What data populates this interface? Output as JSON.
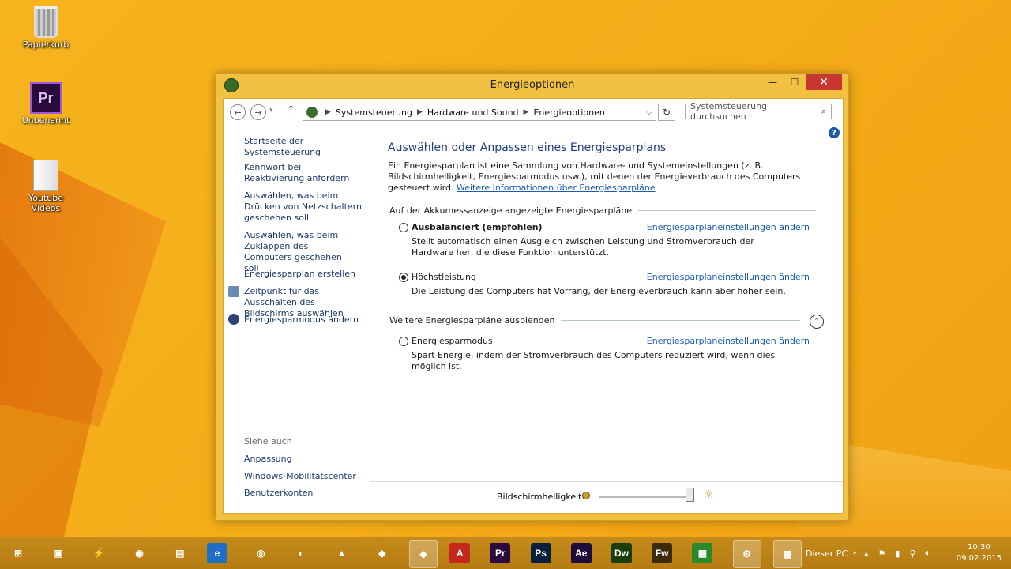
{
  "desktop": {
    "icons": [
      {
        "label": "Papierkorb",
        "icon": "recycle-bin-icon"
      },
      {
        "label": "Unbenannt",
        "icon": "premiere-project-icon",
        "badge": "PROJ",
        "glyph": "Pr"
      },
      {
        "label": "Youtube Videos",
        "icon": "folder-icon"
      }
    ]
  },
  "window": {
    "title": "Energieoptionen",
    "controls": {
      "minimize": "—",
      "maximize": "☐",
      "close": "✕"
    },
    "breadcrumb": [
      "Systemsteuerung",
      "Hardware und Sound",
      "Energieoptionen"
    ],
    "search_placeholder": "Systemsteuerung durchsuchen",
    "help": "?",
    "sidebar": {
      "home": "Startseite der Systemsteuerung",
      "links": [
        "Kennwort bei Reaktivierung anfordern",
        "Auswählen, was beim Drücken von Netzschaltern geschehen soll",
        "Auswählen, was beim Zuklappen des Computers geschehen soll",
        "Energiesparplan erstellen",
        "Zeitpunkt für das Ausschalten des Bildschirms auswählen",
        "Energiesparmodus ändern"
      ],
      "see_also_title": "Siehe auch",
      "see_also": [
        "Anpassung",
        "Windows-Mobilitätscenter",
        "Benutzerkonten"
      ]
    },
    "main": {
      "heading": "Auswählen oder Anpassen eines Energiesparplans",
      "intro": "Ein Energiesparplan ist eine Sammlung von Hardware- und Systemeinstellungen (z. B. Bildschirmhelligkeit, Energiesparmodus usw.), mit denen der Energieverbrauch des Computers gesteuert wird.",
      "intro_link": "Weitere Informationen über Energiesparpläne",
      "section1": "Auf der Akkumessanzeige angezeigte Energiesparpläne",
      "section2": "Weitere Energiesparpläne ausblenden",
      "plan_link": "Energiesparplaneinstellungen ändern",
      "plans": [
        {
          "name": "Ausbalanciert (empfohlen)",
          "desc": "Stellt automatisch einen Ausgleich zwischen Leistung und Stromverbrauch der Hardware her, die diese Funktion unterstützt.",
          "selected": false
        },
        {
          "name": "Höchstleistung",
          "desc": "Die Leistung des Computers hat Vorrang, der Energieverbrauch kann aber höher sein.",
          "selected": true
        },
        {
          "name": "Energiesparmodus",
          "desc": "Spart Energie, indem der Stromverbrauch des Computers reduziert wird, wenn dies möglich ist.",
          "selected": false
        }
      ]
    },
    "brightness": {
      "label": "Bildschirmhelligkeit:",
      "value_fraction": 0.95
    }
  },
  "taskbar": {
    "apps": [
      {
        "name": "start-icon",
        "glyph": "⊞"
      },
      {
        "name": "computer-icon",
        "glyph": "▣"
      },
      {
        "name": "power-icon",
        "glyph": "⚡"
      },
      {
        "name": "network-icon",
        "glyph": "◉"
      },
      {
        "name": "explorer-icon",
        "glyph": "▤"
      },
      {
        "name": "internet-explorer-icon",
        "glyph": "e"
      },
      {
        "name": "chrome-icon",
        "glyph": "◎"
      },
      {
        "name": "firefox-icon",
        "glyph": "◐"
      },
      {
        "name": "vlc-icon",
        "glyph": "▲"
      },
      {
        "name": "app-icon",
        "glyph": "◆"
      },
      {
        "name": "control-panel-icon",
        "glyph": "◆"
      },
      {
        "name": "pdf-icon",
        "glyph": "A"
      },
      {
        "name": "premiere-icon",
        "glyph": "Pr"
      },
      {
        "name": "photoshop-icon",
        "glyph": "Ps"
      },
      {
        "name": "after-effects-icon",
        "glyph": "Ae"
      },
      {
        "name": "dreamweaver-icon",
        "glyph": "Dw"
      },
      {
        "name": "fireworks-icon",
        "glyph": "Fw"
      },
      {
        "name": "store-icon",
        "glyph": "▦"
      },
      {
        "name": "settings-icon",
        "glyph": "⚙"
      },
      {
        "name": "display-icon",
        "glyph": "▩"
      }
    ],
    "tray_label": "Dieser PC",
    "time": "10:30",
    "date": "09.02.2015",
    "colors": {
      "accent": "#f6b41e",
      "taskbar": "#b57c14"
    }
  }
}
